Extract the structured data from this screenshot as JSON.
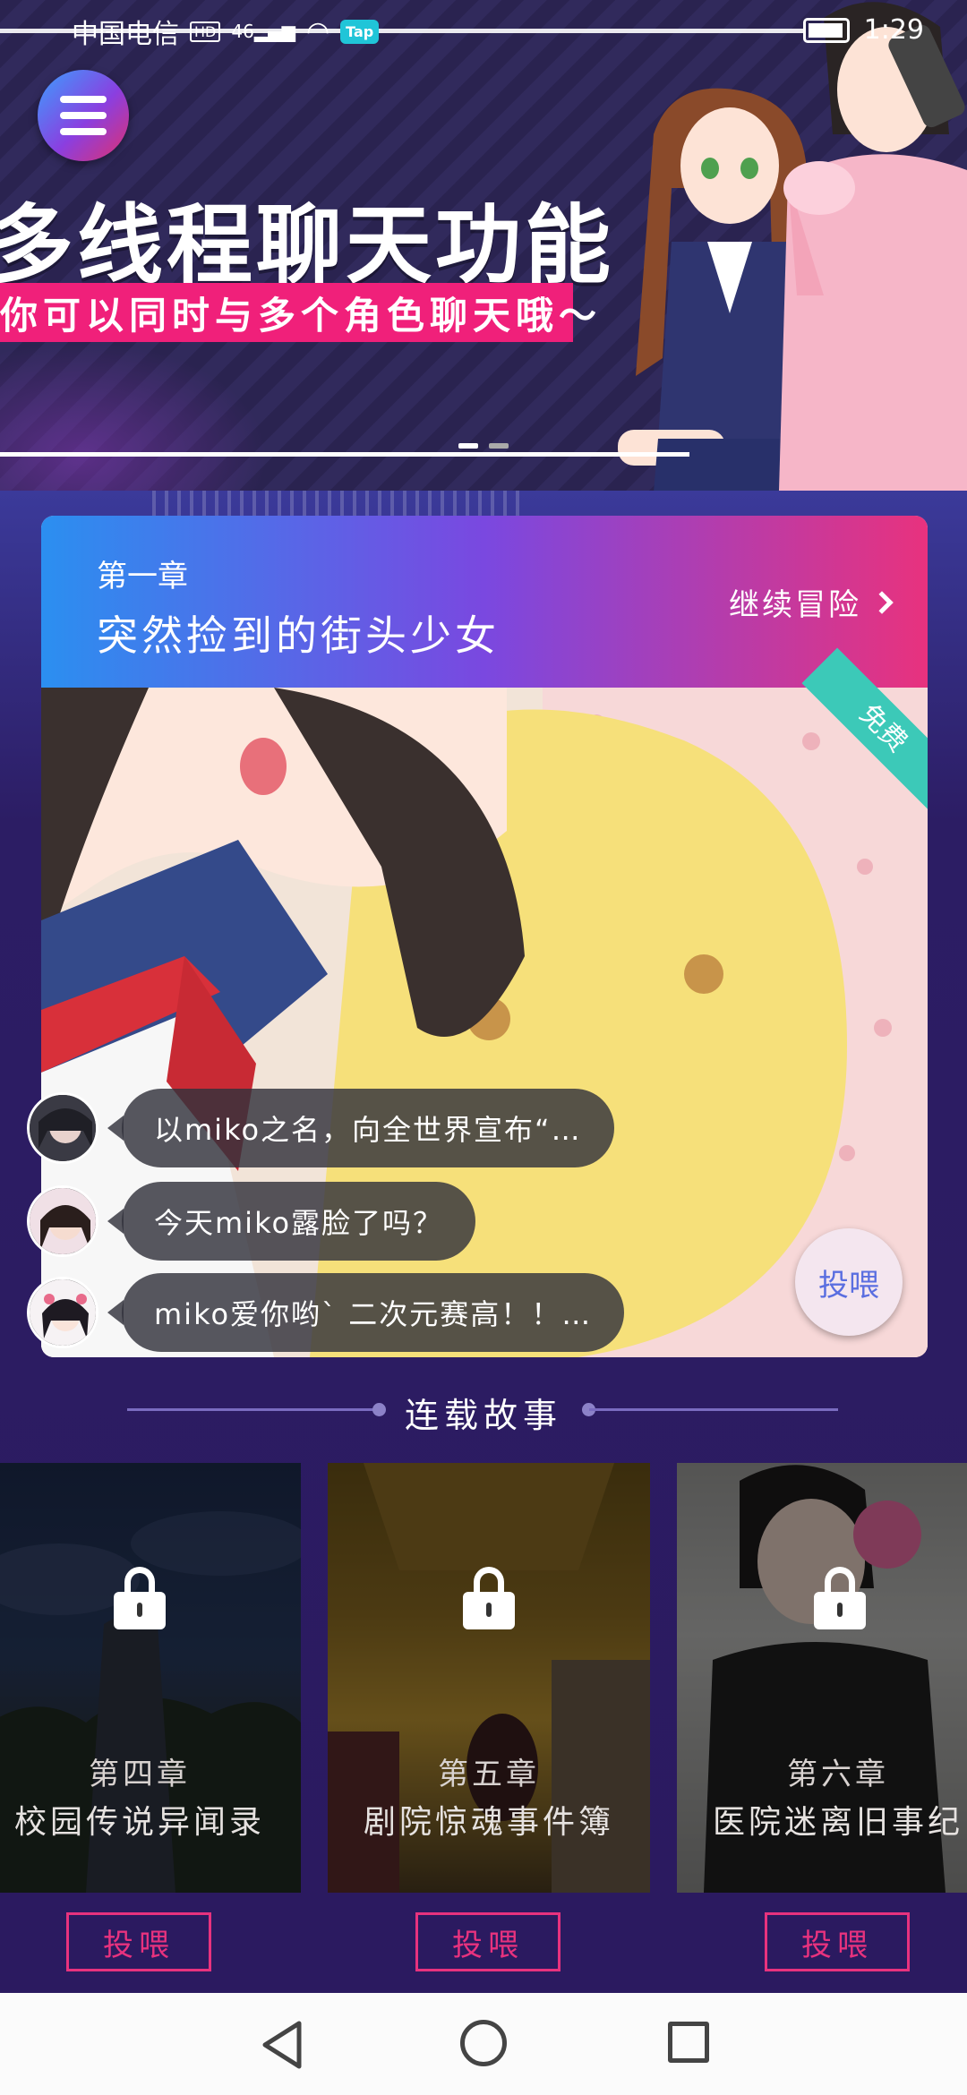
{
  "status_bar": {
    "carrier": "中国电信",
    "hd": "HD",
    "signal": "46",
    "tap_badge": "Tap",
    "time": "1:29"
  },
  "banner": {
    "title": "多线程聊天功能",
    "subtitle": "你可以同时与多个角色聊天哦～",
    "slides": 2,
    "active_slide": 1
  },
  "story": {
    "chapter_label": "第一章",
    "chapter_title": "突然捡到的街头少女",
    "continue_label": "继续冒险",
    "free_tag": "免费",
    "feed_label": "投喂",
    "chats": [
      {
        "text": "以miko之名，向全世界宣布“…"
      },
      {
        "text": "今天miko露脸了吗？"
      },
      {
        "text": "miko爱你哟` 二次元赛高！！…"
      }
    ]
  },
  "serial": {
    "title": "连载故事",
    "chapters": [
      {
        "num": "第四章",
        "name": "校园传说异闻录",
        "feed": "投喂"
      },
      {
        "num": "第五章",
        "name": "剧院惊魂事件簿",
        "feed": "投喂"
      },
      {
        "num": "第六章",
        "name": "医院迷离旧事纪",
        "feed": "投喂"
      }
    ]
  },
  "colors": {
    "accent_pink": "#e8327e",
    "accent_blue": "#2b8ff0",
    "background": "#2b1a60"
  }
}
